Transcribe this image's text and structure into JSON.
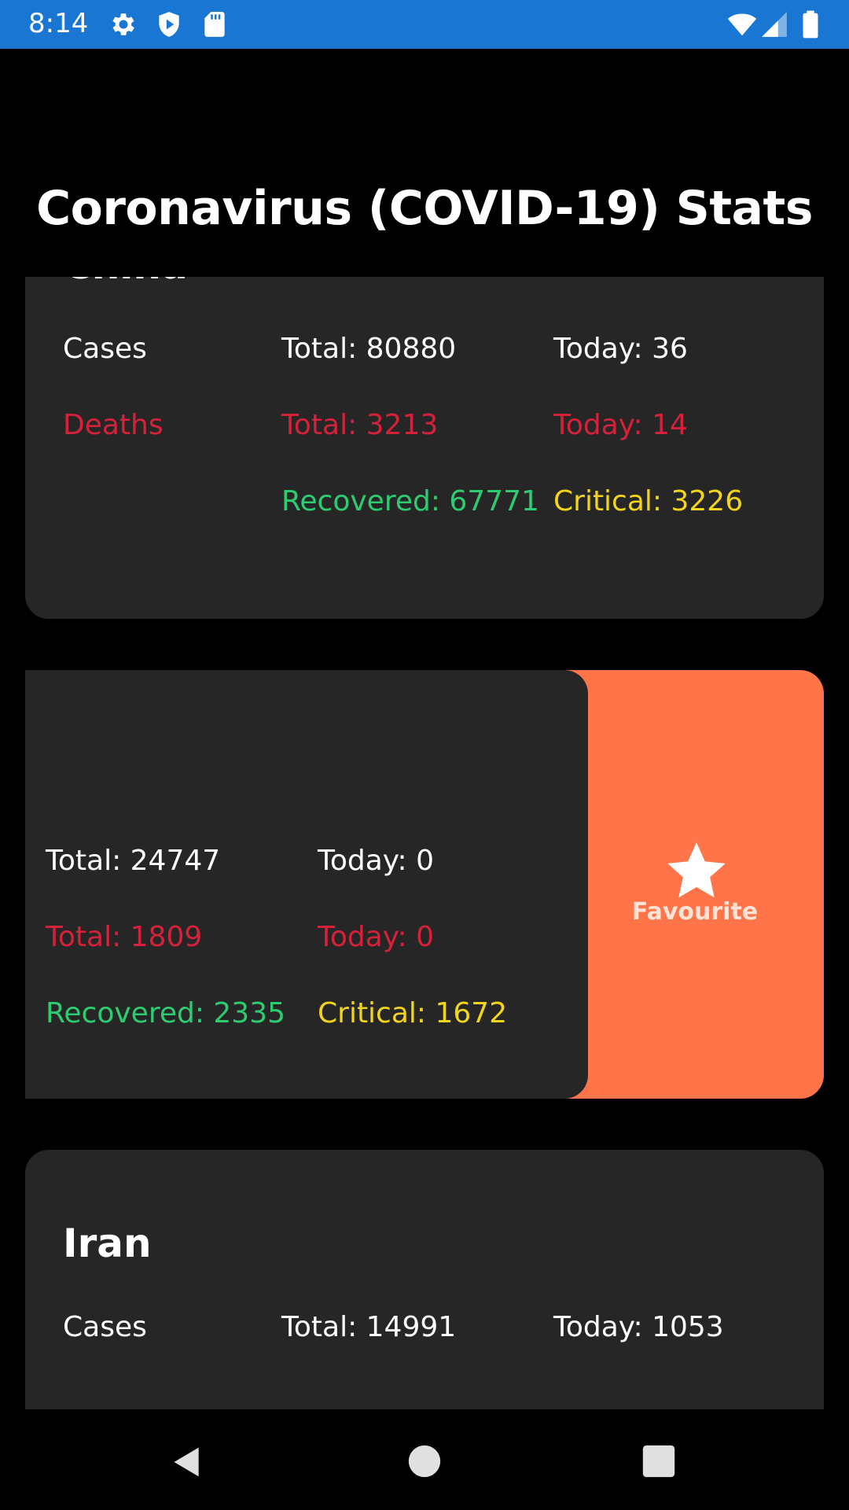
{
  "status_bar": {
    "time": "8:14",
    "icons_left": [
      "gear-icon",
      "shield-icon",
      "sd-card-icon"
    ],
    "icons_right": [
      "wifi-icon",
      "signal-icon",
      "battery-icon"
    ],
    "bg_color": "#1976d2"
  },
  "app": {
    "title": "Coronavirus (COVID-19) Stats"
  },
  "cards": [
    {
      "country": "China",
      "cases_label": "Cases",
      "deaths_label": "Deaths",
      "cases_total": "Total: 80880",
      "cases_today": "Today: 36",
      "deaths_total": "Total: 3213",
      "deaths_today": "Today: 14",
      "recovered": "Recovered: 67771",
      "critical": "Critical: 3226"
    },
    {
      "cases_total": "Total: 24747",
      "cases_today": "Today: 0",
      "deaths_total": "Total: 1809",
      "deaths_today": "Today: 0",
      "recovered": "Recovered: 2335",
      "critical": "Critical: 1672",
      "swipe_action": {
        "label": "Favourite",
        "icon": "star-icon",
        "color": "#ff7448"
      }
    },
    {
      "country": "Iran",
      "cases_label": "Cases",
      "cases_total": "Total: 14991",
      "cases_today": "Today: 1053"
    }
  ],
  "colors": {
    "card_bg": "#262626",
    "deaths": "#d6213b",
    "recovered": "#2ecc71",
    "critical": "#f2d41a"
  },
  "nav_bar": {
    "buttons": [
      "back-icon",
      "home-icon",
      "recents-icon"
    ]
  }
}
